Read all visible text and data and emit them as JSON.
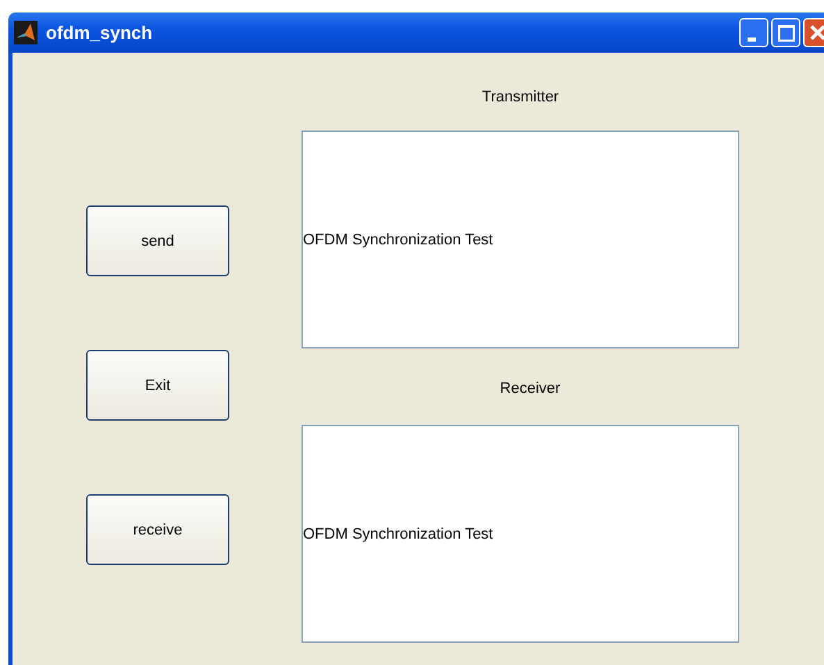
{
  "window": {
    "title": "ofdm_synch"
  },
  "buttons": [
    {
      "label": "send"
    },
    {
      "label": "Exit"
    },
    {
      "label": "receive"
    }
  ],
  "panels": [
    {
      "label": "Transmitter",
      "text": "OFDM Synchronization Test"
    },
    {
      "label": "Receiver",
      "text": "OFDM Synchronization Test"
    }
  ]
}
